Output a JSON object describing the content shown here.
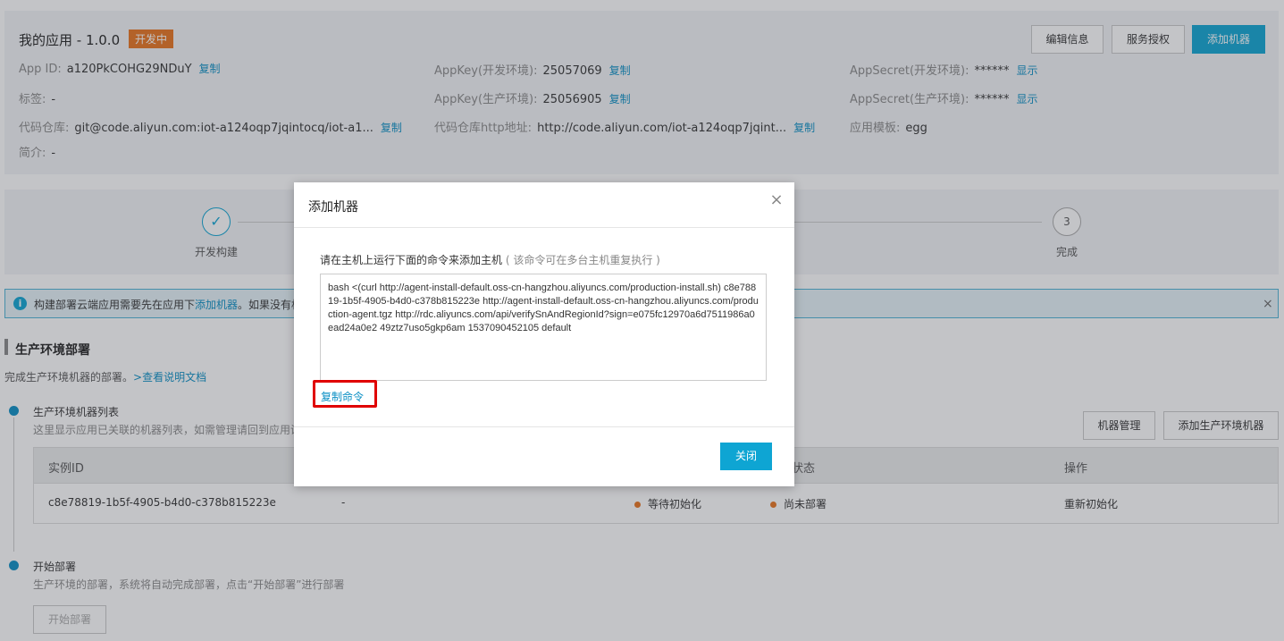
{
  "app": {
    "title": "我的应用 - 1.0.0",
    "status": "开发中",
    "buttons": {
      "edit": "编辑信息",
      "auth": "服务授权",
      "add_machine": "添加机器"
    },
    "fields": {
      "app_id_label": "App ID:",
      "app_id": "a120PkCOHG29NDuY",
      "appkey_dev_label": "AppKey(开发环境):",
      "appkey_dev": "25057069",
      "appsecret_dev_label": "AppSecret(开发环境):",
      "appsecret_dev": "******",
      "tags_label": "标签:",
      "tags": "-",
      "appkey_prod_label": "AppKey(生产环境):",
      "appkey_prod": "25056905",
      "appsecret_prod_label": "AppSecret(生产环境):",
      "appsecret_prod": "******",
      "repo_label": "代码仓库:",
      "repo": "git@code.aliyun.com:iot-a124oqp7jqintocq/iot-a1...",
      "repo_http_label": "代码仓库http地址:",
      "repo_http": "http://code.aliyun.com/iot-a124oqp7jqint...",
      "template_label": "应用模板:",
      "template": "egg",
      "intro_label": "简介:",
      "intro": "-"
    },
    "copy": "复制",
    "show": "显示"
  },
  "steps": {
    "step1_label": "开发构建",
    "step3_number": "3",
    "step3_label": "完成"
  },
  "notice": {
    "icon": "info-icon",
    "text_prefix": "构建部署云端应用需要先在应用下",
    "link": "添加机器",
    "text_suffix": "。如果没有机"
  },
  "section": {
    "title": "生产环境部署",
    "desc": "完成生产环境机器的部署。",
    "doc_link": ">查看说明文档"
  },
  "machine_list": {
    "title": "生产环境机器列表",
    "desc": "这里显示应用已关联的机器列表，如需管理请回到应用设",
    "btn_manage": "机器管理",
    "btn_add": "添加生产环境机器",
    "columns": [
      "实例ID",
      "状态",
      "操作"
    ],
    "rows": [
      {
        "id": "c8e78819-1b5f-4905-b4d0-c378b815223e",
        "col2": "-",
        "init_status": "等待初始化",
        "deploy_status": "尚未部署",
        "action": "重新初始化"
      }
    ]
  },
  "start_deploy": {
    "title": "开始部署",
    "desc": "生产环境的部署，系统将自动完成部署，点击“开始部署”进行部署",
    "button": "开始部署"
  },
  "modal": {
    "title": "添加机器",
    "desc": "请在主机上运行下面的命令来添加主机",
    "note": "( 该命令可在多台主机重复执行 )",
    "command": "bash <(curl http://agent-install-default.oss-cn-hangzhou.aliyuncs.com/production-install.sh) c8e78819-1b5f-4905-b4d0-c378b815223e http://agent-install-default.oss-cn-hangzhou.aliyuncs.com/production-agent.tgz http://rdc.aliyuncs.com/api/verifySnAndRegionId?sign=e075fc12970a6d7511986a0ead24a0e2 49ztz7uso5gkp6am 1537090452105 default",
    "copy_command": "复制命令",
    "close": "关闭"
  },
  "colors": {
    "accent": "#0ea5d3",
    "status_orange": "#e8731e",
    "highlight": "#e00000"
  }
}
